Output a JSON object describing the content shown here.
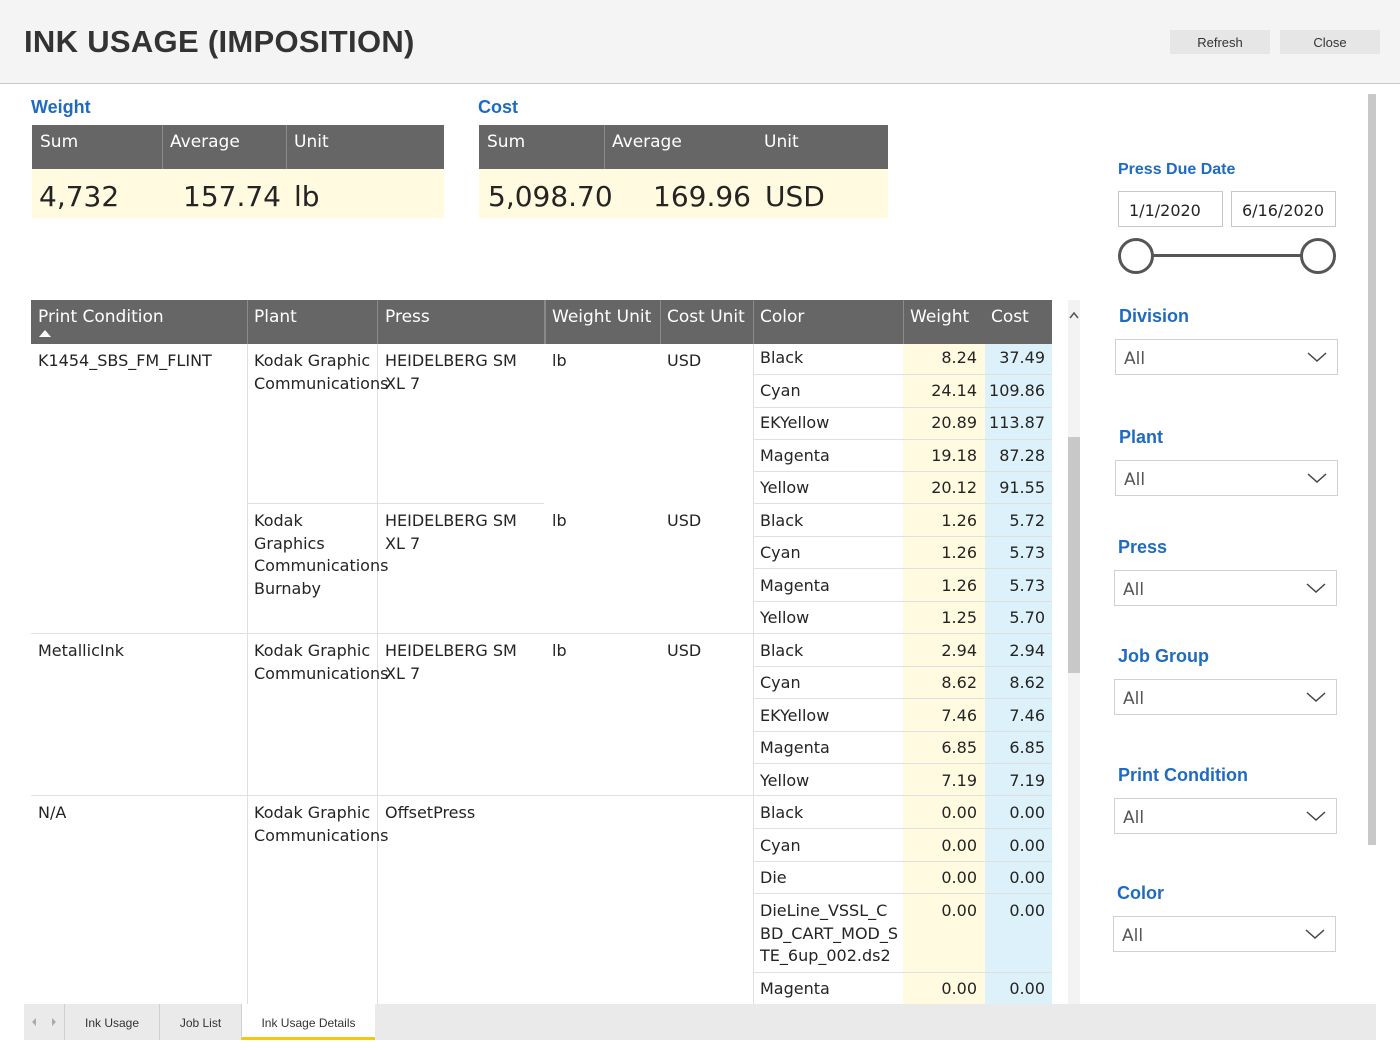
{
  "header": {
    "title": "INK USAGE (IMPOSITION)",
    "refresh_label": "Refresh",
    "close_label": "Close"
  },
  "weight_card": {
    "label": "Weight",
    "headers": [
      "Sum",
      "Average",
      "Unit"
    ],
    "sum": "4,732",
    "average": "157.74",
    "unit": "lb"
  },
  "cost_card": {
    "label": "Cost",
    "headers": [
      "Sum",
      "Average",
      "Unit"
    ],
    "sum": "5,098.70",
    "average": "169.96",
    "unit": "USD"
  },
  "table": {
    "columns": [
      "Print Condition",
      "Plant",
      "Press",
      "Weight Unit",
      "Cost Unit",
      "Color",
      "Weight",
      "Cost"
    ],
    "sort_column": "Print Condition",
    "sort_direction": "ascending",
    "groups": [
      {
        "print_condition": "K1454_SBS_FM_FLINT",
        "plants": [
          {
            "plant": "Kodak Graphic Communications",
            "press": "HEIDELBERG SM XL 7",
            "weight_unit": "lb",
            "cost_unit": "USD",
            "colors": [
              {
                "color": "Black",
                "weight": "8.24",
                "cost": "37.49"
              },
              {
                "color": "Cyan",
                "weight": "24.14",
                "cost": "109.86"
              },
              {
                "color": "EKYellow",
                "weight": "20.89",
                "cost": "113.87"
              },
              {
                "color": "Magenta",
                "weight": "19.18",
                "cost": "87.28"
              },
              {
                "color": "Yellow",
                "weight": "20.12",
                "cost": "91.55"
              }
            ]
          },
          {
            "plant": "Kodak Graphics Communications Burnaby",
            "press": "HEIDELBERG SM XL 7",
            "weight_unit": "lb",
            "cost_unit": "USD",
            "colors": [
              {
                "color": "Black",
                "weight": "1.26",
                "cost": "5.72"
              },
              {
                "color": "Cyan",
                "weight": "1.26",
                "cost": "5.73"
              },
              {
                "color": "Magenta",
                "weight": "1.26",
                "cost": "5.73"
              },
              {
                "color": "Yellow",
                "weight": "1.25",
                "cost": "5.70"
              }
            ]
          }
        ]
      },
      {
        "print_condition": "MetallicInk",
        "plants": [
          {
            "plant": "Kodak Graphic Communications",
            "press": "HEIDELBERG SM XL 7",
            "weight_unit": "lb",
            "cost_unit": "USD",
            "colors": [
              {
                "color": "Black",
                "weight": "2.94",
                "cost": "2.94"
              },
              {
                "color": "Cyan",
                "weight": "8.62",
                "cost": "8.62"
              },
              {
                "color": "EKYellow",
                "weight": "7.46",
                "cost": "7.46"
              },
              {
                "color": "Magenta",
                "weight": "6.85",
                "cost": "6.85"
              },
              {
                "color": "Yellow",
                "weight": "7.19",
                "cost": "7.19"
              }
            ]
          }
        ]
      },
      {
        "print_condition": "N/A",
        "plants": [
          {
            "plant": "Kodak Graphic Communications",
            "press": "OffsetPress",
            "weight_unit": "",
            "cost_unit": "",
            "colors": [
              {
                "color": "Black",
                "weight": "0.00",
                "cost": "0.00"
              },
              {
                "color": "Cyan",
                "weight": "0.00",
                "cost": "0.00"
              },
              {
                "color": "Die",
                "weight": "0.00",
                "cost": "0.00"
              },
              {
                "color": "DieLine_VSSL_CBD_CART_MOD_STE_6up_002.ds2",
                "weight": "0.00",
                "cost": "0.00"
              },
              {
                "color": "Magenta",
                "weight": "0.00",
                "cost": "0.00"
              }
            ]
          }
        ]
      }
    ]
  },
  "filters": {
    "press_due_date": {
      "label": "Press Due Date",
      "start": "1/1/2020",
      "end": "6/16/2020"
    },
    "division": {
      "label": "Division",
      "value": "All"
    },
    "plant": {
      "label": "Plant",
      "value": "All"
    },
    "press": {
      "label": "Press",
      "value": "All"
    },
    "job_group": {
      "label": "Job Group",
      "value": "All"
    },
    "print_condition": {
      "label": "Print Condition",
      "value": "All"
    },
    "color": {
      "label": "Color",
      "value": "All"
    }
  },
  "tabs": [
    {
      "label": "Ink Usage",
      "active": false
    },
    {
      "label": "Job List",
      "active": false
    },
    {
      "label": "Ink Usage Details",
      "active": true
    }
  ],
  "colors": {
    "accent_blue": "#1f6bbf",
    "header_gray": "#666666",
    "weight_highlight": "#fffae0",
    "cost_highlight": "#dcf1f9",
    "active_tab_underline": "#f2c811"
  }
}
